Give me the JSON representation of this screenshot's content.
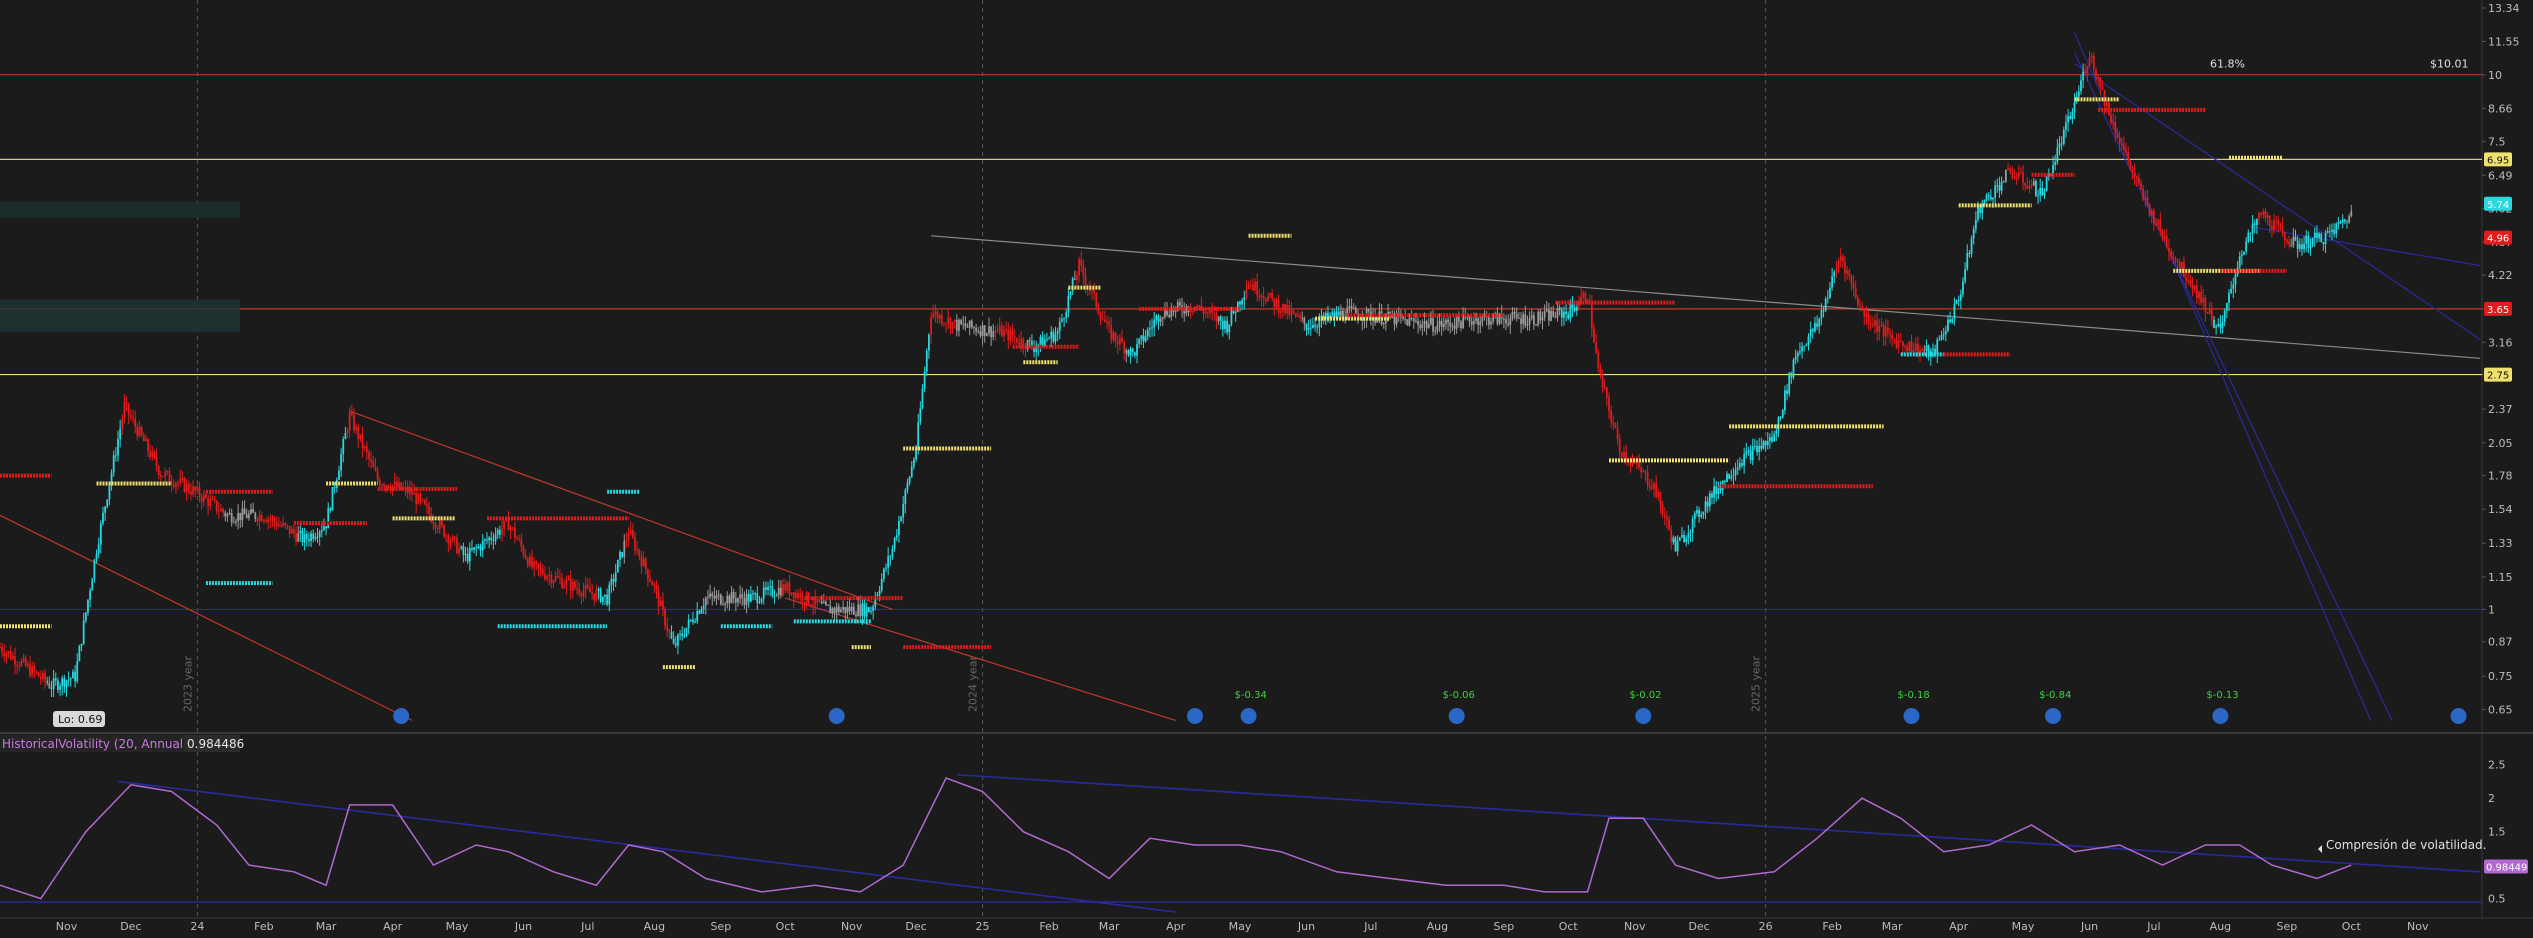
{
  "chart_data": [
    {
      "type": "line",
      "subtype": "candlestick",
      "scale": "log",
      "ylim": [
        0.6,
        13.34
      ],
      "y_ticks": [
        "13.34",
        "11.55",
        "10",
        "8.66",
        "7.5",
        "6.49",
        "5.62",
        "4.87",
        "4.22",
        "3.65",
        "3.16",
        "2.75",
        "2.37",
        "2.05",
        "1.78",
        "1.54",
        "1.33",
        "1.15",
        "1",
        "0.87",
        "0.75",
        "0.65"
      ],
      "y_tick_values": [
        13.34,
        11.55,
        10,
        8.66,
        7.5,
        6.49,
        5.62,
        4.87,
        4.22,
        3.65,
        3.16,
        2.75,
        2.37,
        2.05,
        1.78,
        1.54,
        1.33,
        1.15,
        1,
        0.87,
        0.75,
        0.65
      ],
      "x_ticks": [
        "Nov",
        "Dec",
        "24",
        "Feb",
        "Mar",
        "Apr",
        "May",
        "Jun",
        "Jul",
        "Aug",
        "Sep",
        "Oct",
        "Nov",
        "Dec",
        "25",
        "Feb",
        "Mar",
        "Apr",
        "May",
        "Jun",
        "Jul",
        "Aug",
        "Sep",
        "Oct",
        "Nov",
        "Dec",
        "26",
        "Feb",
        "Mar",
        "Apr",
        "May",
        "Jun",
        "Jul",
        "Aug",
        "Sep",
        "Oct",
        "Nov"
      ],
      "year_markers": [
        "2023 year",
        "2024 year",
        "2025 year"
      ],
      "close_path": [
        [
          "2023-10-01",
          0.85
        ],
        [
          "2023-10-25",
          0.72
        ],
        [
          "2023-11-05",
          0.75
        ],
        [
          "2023-11-15",
          1.3
        ],
        [
          "2023-11-28",
          2.4
        ],
        [
          "2023-12-15",
          1.8
        ],
        [
          "2024-01-01",
          1.65
        ],
        [
          "2024-01-15",
          1.5
        ],
        [
          "2024-02-01",
          1.5
        ],
        [
          "2024-02-20",
          1.35
        ],
        [
          "2024-03-01",
          1.45
        ],
        [
          "2024-03-12",
          2.3
        ],
        [
          "2024-03-25",
          1.75
        ],
        [
          "2024-04-10",
          1.65
        ],
        [
          "2024-04-25",
          1.4
        ],
        [
          "2024-05-05",
          1.25
        ],
        [
          "2024-05-25",
          1.45
        ],
        [
          "2024-06-05",
          1.2
        ],
        [
          "2024-06-25",
          1.1
        ],
        [
          "2024-07-10",
          1.05
        ],
        [
          "2024-07-20",
          1.4
        ],
        [
          "2024-08-01",
          1.1
        ],
        [
          "2024-08-10",
          0.85
        ],
        [
          "2024-08-25",
          1.05
        ],
        [
          "2024-09-15",
          1.05
        ],
        [
          "2024-10-01",
          1.1
        ],
        [
          "2024-10-20",
          1.0
        ],
        [
          "2024-11-10",
          1.0
        ],
        [
          "2024-11-20",
          1.3
        ],
        [
          "2024-12-01",
          2.0
        ],
        [
          "2024-12-08",
          3.6
        ],
        [
          "2024-12-20",
          3.4
        ],
        [
          "2025-01-10",
          3.3
        ],
        [
          "2025-01-25",
          3.1
        ],
        [
          "2025-02-05",
          3.3
        ],
        [
          "2025-02-15",
          4.4
        ],
        [
          "2025-03-01",
          3.3
        ],
        [
          "2025-03-12",
          3.0
        ],
        [
          "2025-03-25",
          3.6
        ],
        [
          "2025-04-10",
          3.7
        ],
        [
          "2025-04-25",
          3.4
        ],
        [
          "2025-05-05",
          4.1
        ],
        [
          "2025-05-15",
          3.8
        ],
        [
          "2025-06-01",
          3.4
        ],
        [
          "2025-06-20",
          3.6
        ],
        [
          "2025-07-10",
          3.5
        ],
        [
          "2025-08-01",
          3.4
        ],
        [
          "2025-08-20",
          3.5
        ],
        [
          "2025-09-15",
          3.5
        ],
        [
          "2025-10-01",
          3.6
        ],
        [
          "2025-10-10",
          3.9
        ],
        [
          "2025-10-15",
          2.8
        ],
        [
          "2025-10-25",
          2.0
        ],
        [
          "2025-11-10",
          1.7
        ],
        [
          "2025-11-20",
          1.3
        ],
        [
          "2025-12-05",
          1.6
        ],
        [
          "2025-12-20",
          1.9
        ],
        [
          "2026-01-05",
          2.1
        ],
        [
          "2026-01-15",
          3.0
        ],
        [
          "2026-01-25",
          3.4
        ],
        [
          "2026-02-05",
          4.6
        ],
        [
          "2026-02-15",
          3.6
        ],
        [
          "2026-03-01",
          3.2
        ],
        [
          "2026-03-20",
          3.0
        ],
        [
          "2026-04-01",
          3.8
        ],
        [
          "2026-04-10",
          5.6
        ],
        [
          "2026-04-25",
          6.6
        ],
        [
          "2026-05-10",
          6.0
        ],
        [
          "2026-05-25",
          8.8
        ],
        [
          "2026-06-01",
          11.0
        ],
        [
          "2026-06-10",
          8.5
        ],
        [
          "2026-06-25",
          6.0
        ],
        [
          "2026-07-10",
          4.6
        ],
        [
          "2026-07-20",
          4.0
        ],
        [
          "2026-08-01",
          3.3
        ],
        [
          "2026-08-10",
          4.6
        ],
        [
          "2026-08-20",
          5.5
        ],
        [
          "2026-09-05",
          4.8
        ],
        [
          "2026-09-20",
          5.0
        ],
        [
          "2026-10-01",
          5.5
        ]
      ],
      "support_resistance_lines": [
        {
          "value": 10.01,
          "color": "#c0392b",
          "label": "61.8%",
          "price_label": "$10.01"
        },
        {
          "value": 6.95,
          "color": "#d9c88a"
        },
        {
          "value": 3.65,
          "color": "#c0392b"
        },
        {
          "value": 2.75,
          "color": "#e8e07a"
        },
        {
          "value": 1,
          "color": "#2a2a9e"
        }
      ],
      "price_badges": [
        {
          "text": "6.95",
          "value": 6.95,
          "color": "#f0e070"
        },
        {
          "text": "5.74",
          "value": 5.74,
          "color": "#2ad8e0"
        },
        {
          "text": "4.96",
          "value": 4.96,
          "color": "#e01c1c"
        },
        {
          "text": "3.65",
          "value": 3.65,
          "color": "#e01c1c"
        },
        {
          "text": "2.75",
          "value": 2.75,
          "color": "#f0e070"
        }
      ],
      "earnings": [
        {
          "date": "2025-05-05",
          "text": "$-0.34"
        },
        {
          "date": "2025-08-10",
          "text": "$-0.06"
        },
        {
          "date": "2025-11-05",
          "text": "$-0.02"
        },
        {
          "date": "2026-03-10",
          "text": "$-0.18"
        },
        {
          "date": "2026-05-15",
          "text": "$-0.84"
        },
        {
          "date": "2026-08-01",
          "text": "$-0.13"
        }
      ],
      "low_label": "Lo: 0.69",
      "colors": {
        "up": "#2ad8e0",
        "down": "#e01c1c",
        "neutral": "#9a9a9a",
        "yellow": "#f0e070"
      }
    },
    {
      "type": "line",
      "title": "HistoricalVolatility (20, Annual)",
      "current_value": "0.984486",
      "value_badge": "0.98449",
      "ylim": [
        0.3,
        2.6
      ],
      "y_ticks": [
        "2.5",
        "2",
        "1.5",
        "1",
        "0.5"
      ],
      "y_tick_values": [
        2.5,
        2,
        1.5,
        1,
        0.5
      ],
      "annotation": "Compresión de volatilidad.",
      "series": [
        {
          "color": "#b06ad0",
          "values": [
            [
              "2023-10-01",
              0.7
            ],
            [
              "2023-10-20",
              0.5
            ],
            [
              "2023-11-10",
              1.5
            ],
            [
              "2023-12-01",
              2.2
            ],
            [
              "2023-12-20",
              2.1
            ],
            [
              "2024-01-10",
              1.6
            ],
            [
              "2024-01-25",
              1.0
            ],
            [
              "2024-02-15",
              0.9
            ],
            [
              "2024-03-01",
              0.7
            ],
            [
              "2024-03-12",
              1.9
            ],
            [
              "2024-04-01",
              1.9
            ],
            [
              "2024-04-20",
              1.0
            ],
            [
              "2024-05-10",
              1.3
            ],
            [
              "2024-05-25",
              1.2
            ],
            [
              "2024-06-15",
              0.9
            ],
            [
              "2024-07-05",
              0.7
            ],
            [
              "2024-07-20",
              1.3
            ],
            [
              "2024-08-05",
              1.2
            ],
            [
              "2024-08-25",
              0.8
            ],
            [
              "2024-09-20",
              0.6
            ],
            [
              "2024-10-15",
              0.7
            ],
            [
              "2024-11-05",
              0.6
            ],
            [
              "2024-11-25",
              1.0
            ],
            [
              "2024-12-15",
              2.3
            ],
            [
              "2025-01-01",
              2.1
            ],
            [
              "2025-01-20",
              1.5
            ],
            [
              "2025-02-10",
              1.2
            ],
            [
              "2025-03-01",
              0.8
            ],
            [
              "2025-03-20",
              1.4
            ],
            [
              "2025-04-10",
              1.3
            ],
            [
              "2025-05-01",
              1.3
            ],
            [
              "2025-05-20",
              1.2
            ],
            [
              "2025-06-15",
              0.9
            ],
            [
              "2025-07-10",
              0.8
            ],
            [
              "2025-08-05",
              0.7
            ],
            [
              "2025-09-01",
              0.7
            ],
            [
              "2025-09-20",
              0.6
            ],
            [
              "2025-10-10",
              0.6
            ],
            [
              "2025-10-20",
              1.7
            ],
            [
              "2025-11-05",
              1.7
            ],
            [
              "2025-11-20",
              1.0
            ],
            [
              "2025-12-10",
              0.8
            ],
            [
              "2026-01-05",
              0.9
            ],
            [
              "2026-01-25",
              1.4
            ],
            [
              "2026-02-15",
              2.0
            ],
            [
              "2026-03-05",
              1.7
            ],
            [
              "2026-03-25",
              1.2
            ],
            [
              "2026-04-15",
              1.3
            ],
            [
              "2026-05-05",
              1.6
            ],
            [
              "2026-05-25",
              1.2
            ],
            [
              "2026-06-15",
              1.3
            ],
            [
              "2026-07-05",
              1.0
            ],
            [
              "2026-07-25",
              1.3
            ],
            [
              "2026-08-10",
              1.3
            ],
            [
              "2026-08-25",
              1.0
            ],
            [
              "2026-09-15",
              0.8
            ],
            [
              "2026-10-01",
              1.0
            ]
          ]
        }
      ]
    }
  ]
}
